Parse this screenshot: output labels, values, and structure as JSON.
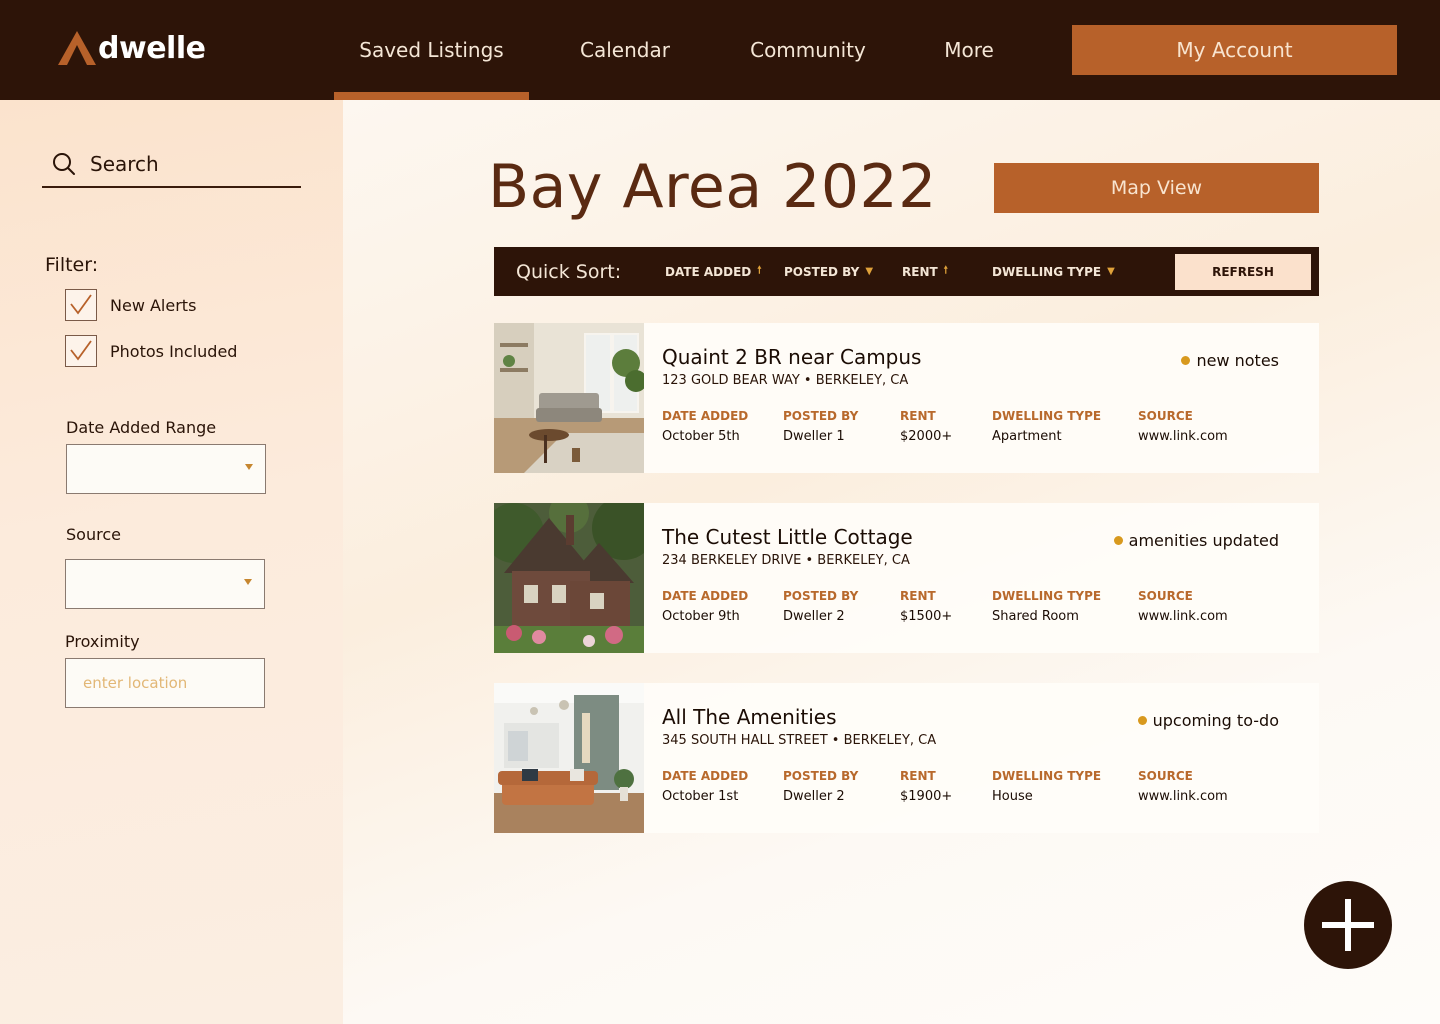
{
  "brand": {
    "name": "dwelle"
  },
  "nav": {
    "items": [
      {
        "label": "Saved Listings"
      },
      {
        "label": "Calendar"
      },
      {
        "label": "Community"
      },
      {
        "label": "More"
      }
    ],
    "account_label": "My Account"
  },
  "sidebar": {
    "search_placeholder": "Search",
    "filter_label": "Filter:",
    "checks": [
      {
        "label": "New Alerts",
        "checked": true
      },
      {
        "label": "Photos Included",
        "checked": true
      }
    ],
    "date_range_label": "Date Added Range",
    "source_label": "Source",
    "proximity_label": "Proximity",
    "proximity_placeholder": "enter location"
  },
  "main": {
    "title": "Bay Area 2022",
    "map_view_label": "Map View",
    "sort": {
      "title": "Quick Sort:",
      "items": [
        {
          "label": "DATE ADDED",
          "arrow": "🠕"
        },
        {
          "label": "POSTED BY",
          "arrow": "▼"
        },
        {
          "label": "RENT",
          "arrow": "🠕"
        },
        {
          "label": "DWELLING TYPE",
          "arrow": "▼"
        }
      ],
      "refresh_label": "REFRESH"
    },
    "columns": [
      "DATE ADDED",
      "POSTED BY",
      "RENT",
      "DWELLING TYPE",
      "SOURCE"
    ],
    "listings": [
      {
        "title": "Quaint 2 BR near Campus",
        "address": "123 GOLD BEAR WAY • BERKELEY, CA",
        "status": "new notes",
        "date_added": "October 5th",
        "posted_by": "Dweller 1",
        "rent": "$2000+",
        "dwelling_type": "Apartment",
        "source": "www.link.com"
      },
      {
        "title": "The Cutest Little Cottage",
        "address": "234 BERKELEY DRIVE • BERKELEY, CA",
        "status": "amenities updated",
        "date_added": "October 9th",
        "posted_by": "Dweller 2",
        "rent": "$1500+",
        "dwelling_type": "Shared Room",
        "source": "www.link.com"
      },
      {
        "title": "All The Amenities",
        "address": "345 SOUTH HALL STREET • BERKELEY, CA",
        "status": "upcoming to-do",
        "date_added": "October 1st",
        "posted_by": "Dweller 2",
        "rent": "$1900+",
        "dwelling_type": "House",
        "source": "www.link.com"
      }
    ]
  },
  "colors": {
    "dark_brown": "#2d1408",
    "accent": "#b7612a",
    "status_dot": "#d8991e",
    "label_brown": "#b8692c"
  },
  "icons": {
    "logo": "triangle-a-icon",
    "search": "search-icon",
    "check": "checkmark-icon",
    "caret": "caret-down-icon",
    "add": "plus-icon"
  }
}
